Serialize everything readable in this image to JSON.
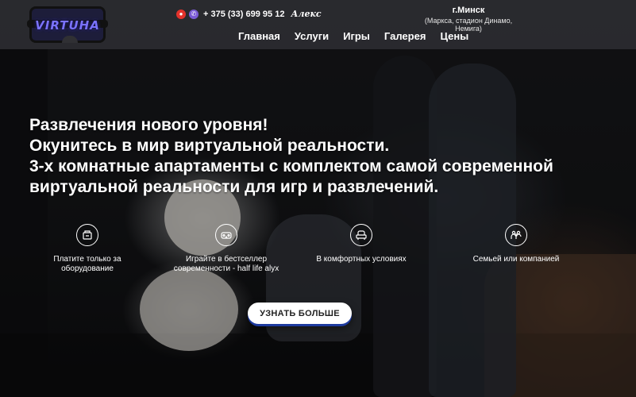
{
  "header": {
    "logo_text": "VIRTUHA",
    "phone": "+ 375 (33) 699 95 12",
    "contact_name": "Алекс",
    "city": "г.Минск",
    "address": "(Маркса, стадион Динамо, Немига)",
    "nav": [
      "Главная",
      "Услуги",
      "Игры",
      "Галерея",
      "Цены"
    ]
  },
  "hero": {
    "lines": [
      "Развлечения нового уровня!",
      "Окунитесь в мир виртуальной реальности.",
      "3-х комнатные апартаменты с комплектом самой современной",
      "виртуальной реальности для игр и развлечений."
    ]
  },
  "features": [
    {
      "icon": "vr-equipment-icon",
      "label": "Платите только за оборудование"
    },
    {
      "icon": "vr-headset-icon",
      "label": "Играйте в бестселлер современности - half life alyx"
    },
    {
      "icon": "armchair-icon",
      "label": "В комфортных условиях"
    },
    {
      "icon": "family-icon",
      "label": "Семьей или компанией"
    }
  ],
  "cta": {
    "label": "УЗНАТЬ БОЛЬШЕ"
  },
  "colors": {
    "header_bg": "#303034",
    "logo_accent": "#7a72ff",
    "cta_shadow": "#1d3a9e"
  }
}
